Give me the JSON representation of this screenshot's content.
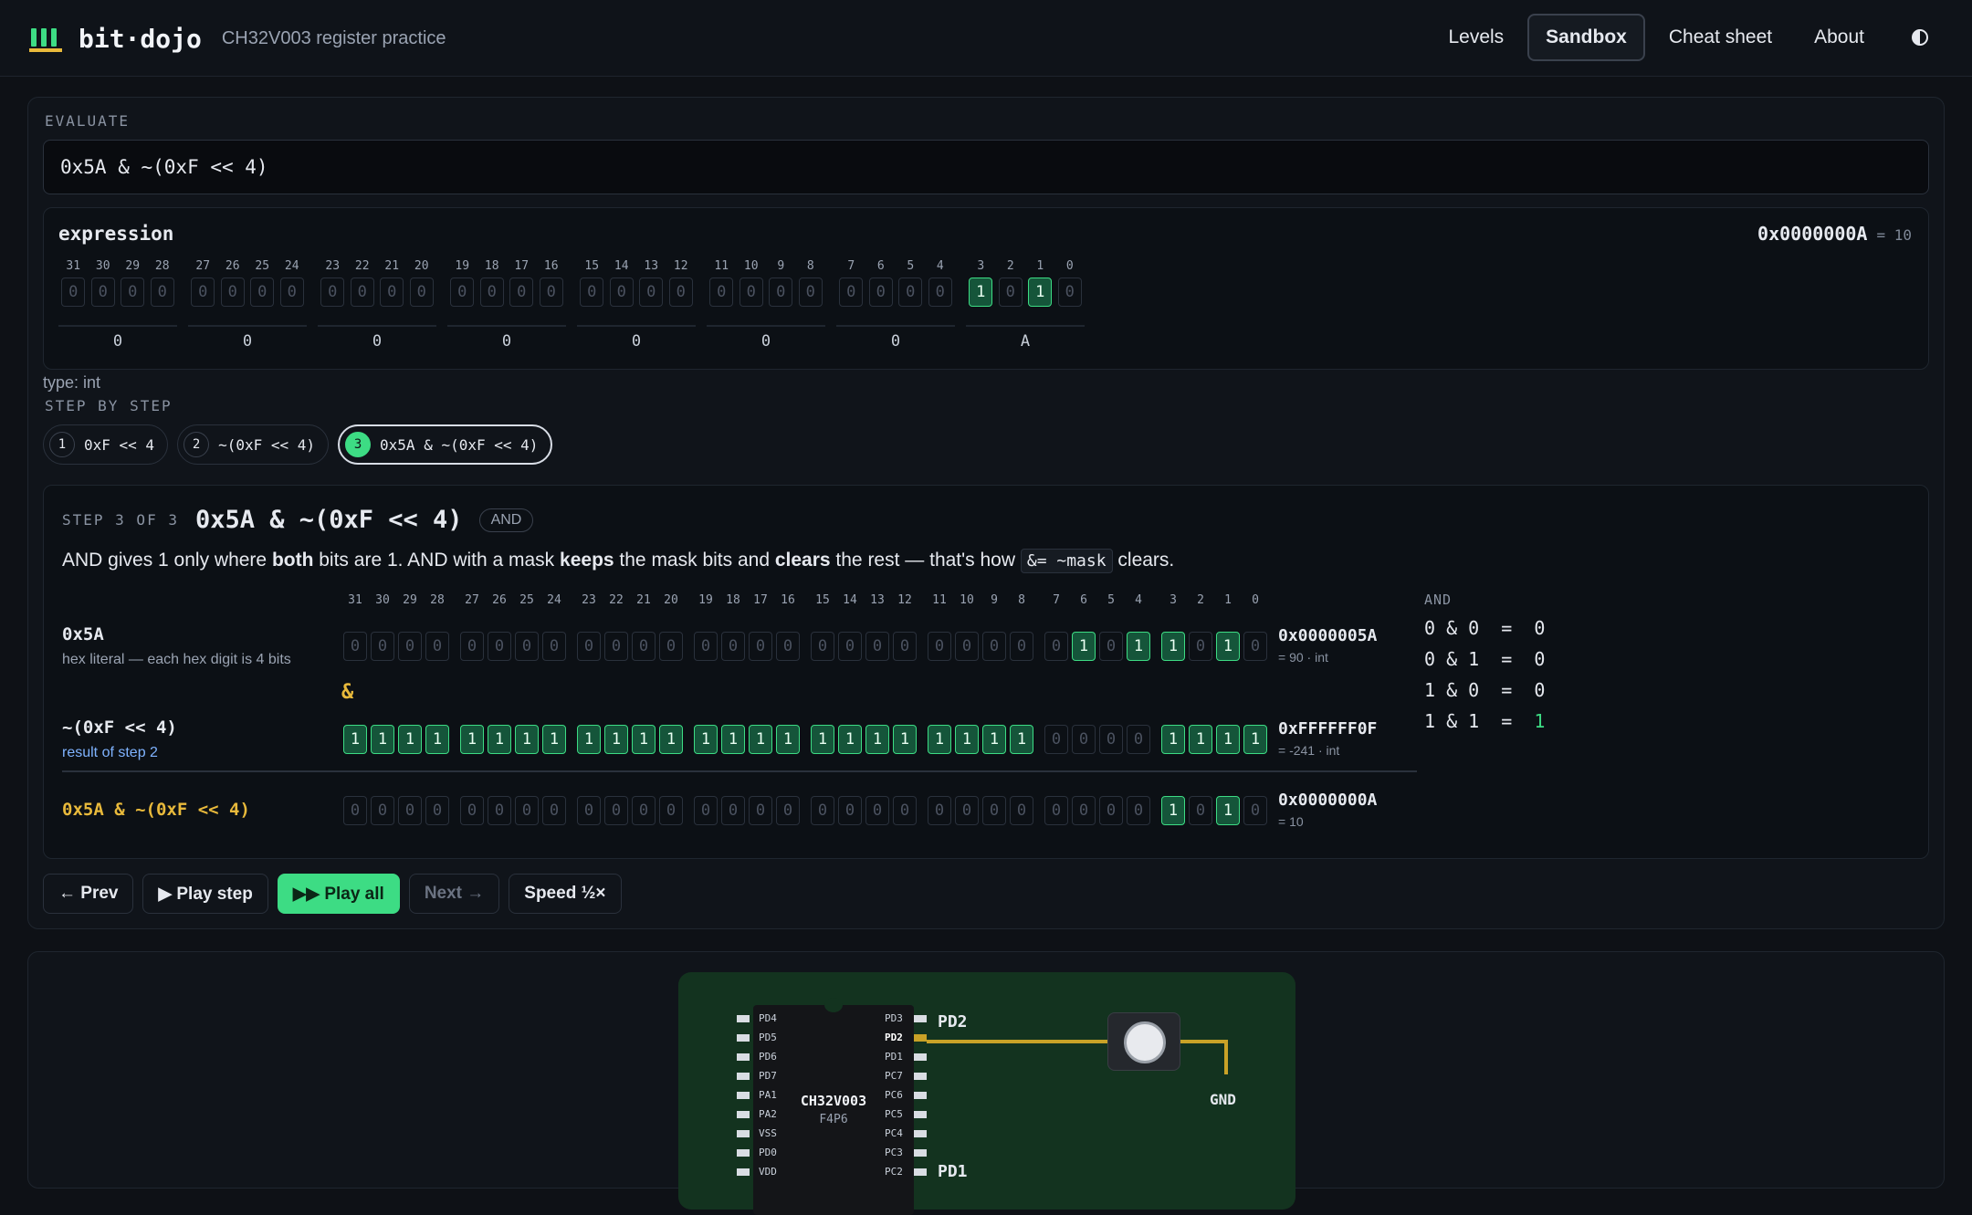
{
  "header": {
    "brand": "bit·dojo",
    "subtitle": "CH32V003 register practice",
    "nav": [
      {
        "label": "Levels"
      },
      {
        "label": "Sandbox"
      },
      {
        "label": "Cheat sheet"
      },
      {
        "label": "About"
      }
    ],
    "active_nav": "Sandbox",
    "theme_icon": "contrast-icon"
  },
  "evaluate": {
    "label": "EVALUATE",
    "input_value": "0x5A & ~(0xF << 4)"
  },
  "expression": {
    "title": "expression",
    "hex": "0x0000000A",
    "dec": "= 10",
    "bit_labels": [
      "31",
      "30",
      "29",
      "28",
      "27",
      "26",
      "25",
      "24",
      "23",
      "22",
      "21",
      "20",
      "19",
      "18",
      "17",
      "16",
      "15",
      "14",
      "13",
      "12",
      "11",
      "10",
      "9",
      "8",
      "7",
      "6",
      "5",
      "4",
      "3",
      "2",
      "1",
      "0"
    ],
    "bits": [
      0,
      0,
      0,
      0,
      0,
      0,
      0,
      0,
      0,
      0,
      0,
      0,
      0,
      0,
      0,
      0,
      0,
      0,
      0,
      0,
      0,
      0,
      0,
      0,
      0,
      0,
      0,
      0,
      1,
      0,
      1,
      0
    ],
    "nibbles": [
      "0",
      "0",
      "0",
      "0",
      "0",
      "0",
      "0",
      "A"
    ],
    "type": "type: int"
  },
  "step_by_step": {
    "label": "STEP BY STEP",
    "chips": [
      {
        "num": "1",
        "label": "0xF << 4"
      },
      {
        "num": "2",
        "label": "~(0xF << 4)"
      },
      {
        "num": "3",
        "label": "0x5A & ~(0xF << 4)"
      }
    ],
    "active_chip": 3
  },
  "step": {
    "counter": "STEP 3 OF 3",
    "expr": "0x5A & ~(0xF << 4)",
    "badge": "AND",
    "desc": {
      "p1": "AND gives 1 only where ",
      "b1": "both",
      "p2": " bits are 1. AND with a mask ",
      "b2": "keeps",
      "p3": " the mask bits and ",
      "b3": "clears",
      "p4": " the rest — that's how ",
      "code": "&= ~mask",
      "p5": " clears."
    },
    "operator": "&",
    "rows": [
      {
        "label": "0x5A",
        "sub": "hex literal — each hex digit is 4 bits",
        "hex": "0x0000005A",
        "meta": "= 90 · int",
        "bits": [
          0,
          0,
          0,
          0,
          0,
          0,
          0,
          0,
          0,
          0,
          0,
          0,
          0,
          0,
          0,
          0,
          0,
          0,
          0,
          0,
          0,
          0,
          0,
          0,
          0,
          1,
          0,
          1,
          1,
          0,
          1,
          0
        ]
      },
      {
        "label": "~(0xF << 4)",
        "sub": "result of step 2",
        "hex": "0xFFFFFF0F",
        "meta": "= -241 · int",
        "bits": [
          1,
          1,
          1,
          1,
          1,
          1,
          1,
          1,
          1,
          1,
          1,
          1,
          1,
          1,
          1,
          1,
          1,
          1,
          1,
          1,
          1,
          1,
          1,
          1,
          0,
          0,
          0,
          0,
          1,
          1,
          1,
          1
        ]
      },
      {
        "label": "0x5A & ~(0xF << 4)",
        "sub": "",
        "hex": "0x0000000A",
        "meta": "= 10",
        "bits": [
          0,
          0,
          0,
          0,
          0,
          0,
          0,
          0,
          0,
          0,
          0,
          0,
          0,
          0,
          0,
          0,
          0,
          0,
          0,
          0,
          0,
          0,
          0,
          0,
          0,
          0,
          0,
          0,
          1,
          0,
          1,
          0
        ]
      }
    ],
    "truth_table": {
      "title": "AND",
      "rows": [
        {
          "expr": "0 & 0  =  ",
          "res": "0"
        },
        {
          "expr": "0 & 1  =  ",
          "res": "0"
        },
        {
          "expr": "1 & 0  =  ",
          "res": "0"
        },
        {
          "expr": "1 & 1  =  ",
          "res": "1"
        }
      ]
    }
  },
  "controls": {
    "prev": "← Prev",
    "play_step": "▶ Play step",
    "play_all": "▶▶ Play all",
    "next": "Next →",
    "speed": "Speed ½×"
  },
  "board": {
    "chip_name": "CH32V003",
    "chip_pkg": "F4P6",
    "left_pins": [
      "PD4",
      "PD5",
      "PD6",
      "PD7",
      "PA1",
      "PA2",
      "VSS",
      "PD0",
      "VDD"
    ],
    "right_pins": [
      "PD3",
      "PD2",
      "PD1",
      "PC7",
      "PC6",
      "PC5",
      "PC4",
      "PC3",
      "PC2"
    ],
    "pd2_label": "PD2",
    "pd1_label": "PD1",
    "gnd_label": "GND"
  },
  "colors": {
    "bit_on": "#3ddc84",
    "accent_orange": "#e8b93b",
    "link_blue": "#7fb3ff"
  }
}
